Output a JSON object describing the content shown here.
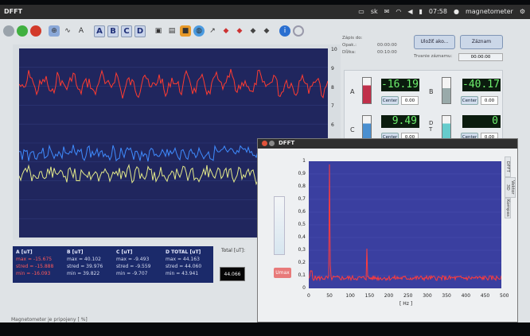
{
  "topbar": {
    "app_title": "DFFT",
    "lang": "sk",
    "time": "07:58",
    "user": "magnetometer"
  },
  "plot": {
    "y_ticks": [
      "10",
      "9",
      "8",
      "7",
      "6",
      "5",
      "4",
      "3",
      "2",
      "1",
      "0"
    ]
  },
  "stats": {
    "A": {
      "header": "A [uT]",
      "max": "max = -15.675",
      "stred": "stred = -15.888",
      "min": "min = -16.093"
    },
    "B": {
      "header": "B [uT]",
      "max": "max = 40.102",
      "stred": "stred = 39.976",
      "min": "min = 39.822"
    },
    "C": {
      "header": "C [uT]",
      "max": "max = -9.493",
      "stred": "stred = -9.559",
      "min": "min = -9.707"
    },
    "D": {
      "header": "D TOTAL [uT]",
      "max": "max = 44.163",
      "stred": "stred = 44.060",
      "min": "min = 43.941"
    }
  },
  "total": {
    "label": "Total [uT]:",
    "value": "44.066"
  },
  "status": "Magnetometer je pripojeny [ %]",
  "recording": {
    "zapis_label": "Zápis do:",
    "opak_label": "Opak.:",
    "opak_value": "00:00:00",
    "dlzka_label": "Dĺžka:",
    "dlzka_value": "00:10:00",
    "trvanie_label": "Trvanie záznamu:",
    "trvanie_value": "00:00:00",
    "save_button": "Uložiť ako...",
    "record_button": "Záznam"
  },
  "meters": {
    "A": {
      "label": "A",
      "value": "-16.19"
    },
    "B": {
      "label": "B",
      "value": "-40.17"
    },
    "C": {
      "label": "C",
      "value": "9.49"
    },
    "D": {
      "label": "D T",
      "value": "0"
    },
    "center_label": "Center",
    "offset_value": "0.00"
  },
  "dfft": {
    "title": "DFFT",
    "umax_label": "Umax",
    "tabs": [
      "DFFT",
      "Vektor 3D",
      "Kompas"
    ],
    "x_label": "[ Hz ]",
    "x_ticks": [
      "0",
      "50",
      "100",
      "150",
      "200",
      "250",
      "300",
      "350",
      "400",
      "450",
      "500"
    ],
    "y_ticks": [
      "1",
      "0,9",
      "0,8",
      "0,7",
      "0,6",
      "0,5",
      "0,4",
      "0,3",
      "0,2",
      "0,1",
      "0"
    ]
  },
  "colors": {
    "plot_bg": "#20265e",
    "trace_a": "#ff3b30",
    "trace_b": "#3f8cff",
    "trace_c": "#e4ea8a",
    "fft_bg": "#3a3fa0",
    "fft_trace": "#ff3c3c",
    "lcd_text": "#6ef06e"
  }
}
